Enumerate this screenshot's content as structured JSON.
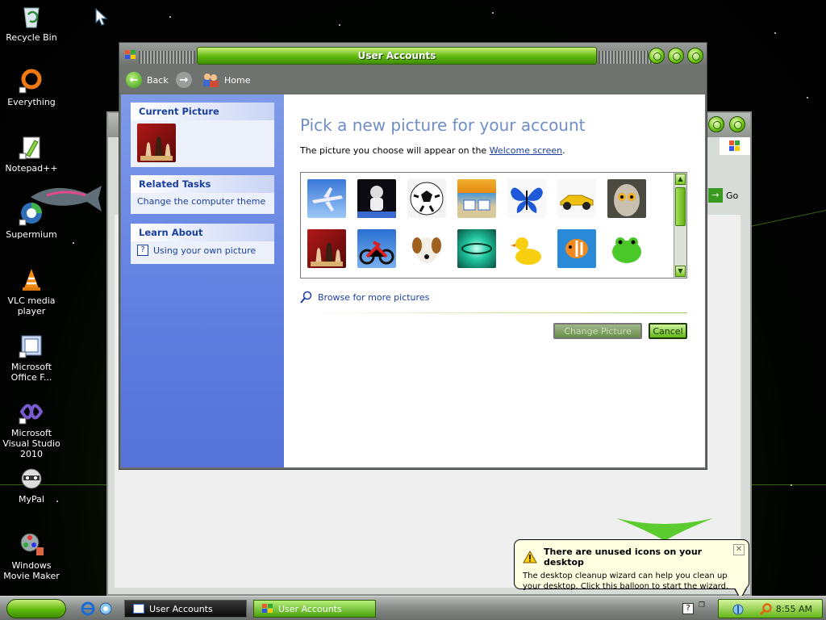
{
  "desktop": {
    "icons": [
      {
        "label": "Recycle Bin",
        "icon": "recycle-bin-icon"
      },
      {
        "label": "Everything",
        "icon": "everything-search-icon"
      },
      {
        "label": "Notepad++",
        "icon": "notepad-plus-plus-icon"
      },
      {
        "label": "Supermium",
        "icon": "supermium-browser-icon"
      },
      {
        "label": "VLC media player",
        "icon": "vlc-cone-icon"
      },
      {
        "label": "Microsoft Office F...",
        "icon": "office-file-icon"
      },
      {
        "label": "Microsoft Visual Studio 2010",
        "icon": "visual-studio-icon"
      },
      {
        "label": "MyPal",
        "icon": "mypal-raccoon-icon"
      },
      {
        "label": "Windows Movie Maker",
        "icon": "movie-maker-icon"
      }
    ]
  },
  "window": {
    "title": "User Accounts",
    "nav": {
      "back": "Back",
      "home": "Home"
    },
    "left": {
      "current_picture": {
        "title": "Current Picture"
      },
      "related_tasks": {
        "title": "Related Tasks",
        "items": [
          "Change the computer theme"
        ]
      },
      "learn_about": {
        "title": "Learn About",
        "items": [
          "Using your own picture"
        ]
      }
    },
    "main": {
      "heading": "Pick a new picture for your account",
      "subtext_before": "The picture you choose will appear on the ",
      "subtext_link": "Welcome screen",
      "subtext_after": ".",
      "pictures": [
        "airplane",
        "astronaut",
        "soccer ball",
        "beach chairs",
        "butterfly",
        "race car",
        "owl",
        "chess",
        "dirt bike",
        "dog",
        "green ripple",
        "rubber duck",
        "fish",
        "frog"
      ],
      "browse": "Browse for more pictures",
      "change_button": "Change Picture",
      "cancel_button": "Cancel"
    }
  },
  "background_window": {
    "go": "Go"
  },
  "taskbar": {
    "items": [
      "User Accounts",
      "User Accounts"
    ],
    "clock": "8:55 AM"
  },
  "balloon": {
    "title": "There are unused icons on your desktop",
    "body": "The desktop cleanup wizard can help you clean up your desktop. Click this balloon to start the wizard."
  },
  "colors": {
    "accent_green": "#5fb80e",
    "heading_blue": "#6f8fc4",
    "task_pane_blue": "#5f7ee0"
  }
}
